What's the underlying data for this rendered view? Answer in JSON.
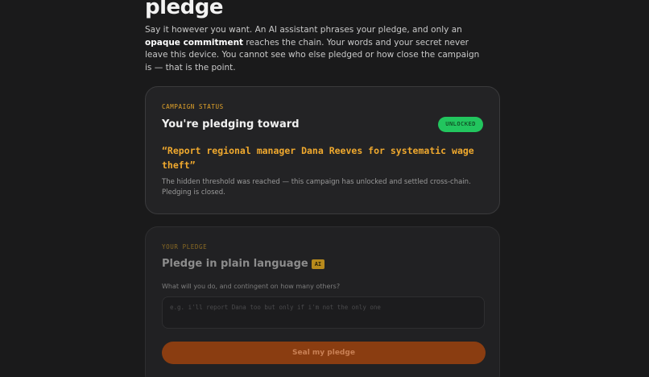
{
  "header": {
    "title": "pledge",
    "intro_before": "Say it however you want. An AI assistant phrases your pledge, and only an ",
    "intro_strong": "opaque commitment",
    "intro_after": " reaches the chain. Your words and your secret never leave this device. You cannot see who else pledged or how close the campaign is — that is the point."
  },
  "campaign": {
    "eyebrow": "CAMPAIGN STATUS",
    "title": "You're pledging toward",
    "status_badge": "UNLOCKED",
    "quote": "“Report regional manager Dana Reeves for systematic wage theft”",
    "note": "The hidden threshold was reached — this campaign has unlocked and settled cross-chain. Pledging is closed."
  },
  "pledge": {
    "eyebrow": "YOUR PLEDGE",
    "title": "Pledge in plain language",
    "ai_tag": "AI",
    "field_label": "What will you do, and contingent on how many others?",
    "field_value": "",
    "field_placeholder": "e.g. i'll report Dana too but only if i'm not the only one",
    "submit_label": "Seal my pledge"
  },
  "colors": {
    "accent": "#f0a92e",
    "badge_green": "#22c55e",
    "button_orange": "#8a3d11",
    "background": "#1a1a1b"
  }
}
